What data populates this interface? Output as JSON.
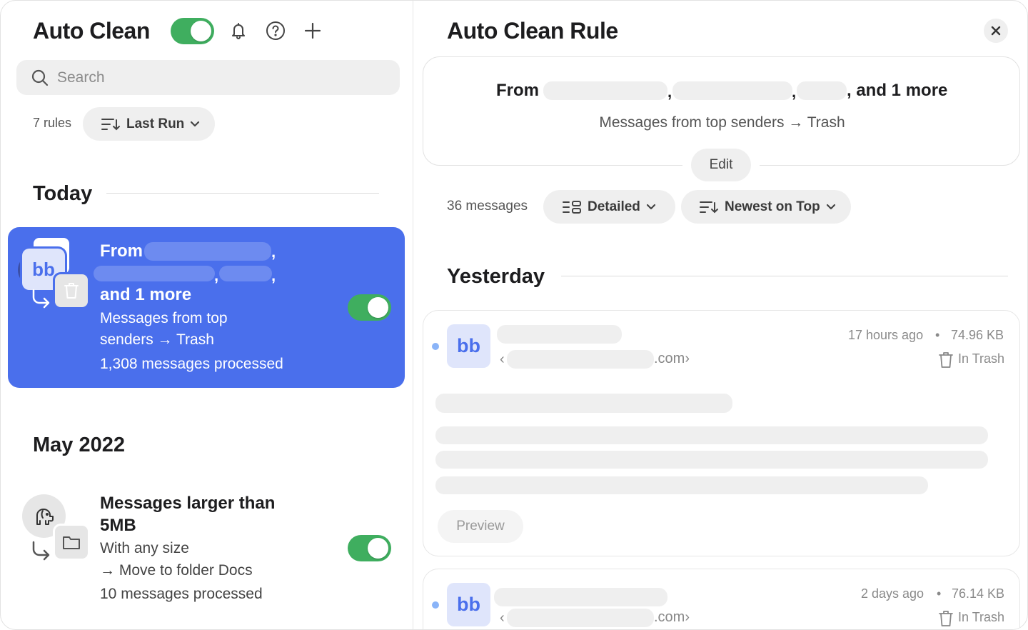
{
  "left": {
    "app_title": "Auto Clean",
    "search_placeholder": "Search",
    "rules_count": "7 rules",
    "sort_label": "Last Run",
    "sections": [
      {
        "title": "Today",
        "rule": {
          "from_label": "From",
          "more_label": "and 1 more",
          "description_line1": "Messages from top",
          "description_line2": "senders → Trash",
          "processed": "1,308 messages processed",
          "avatar_text": "bb",
          "enabled": true
        }
      },
      {
        "title": "May 2022",
        "rule": {
          "title_line1": "Messages larger than",
          "title_line2": "5MB",
          "description_line1": "With any size",
          "description_line2": "→ Move to folder Docs",
          "processed": "10 messages processed",
          "enabled": true
        }
      }
    ]
  },
  "right": {
    "title": "Auto Clean Rule",
    "summary": {
      "from_label": "From",
      "more_label": ", and 1 more",
      "description": "Messages from top senders → Trash",
      "edit_label": "Edit"
    },
    "message_count": "36 messages",
    "view_label": "Detailed",
    "order_label": "Newest on Top",
    "section_title": "Yesterday",
    "messages": [
      {
        "avatar_text": "bb",
        "domain_suffix": ".com›",
        "open_bracket": "‹",
        "time": "17 hours ago",
        "separator": "•",
        "size": "74.96 KB",
        "status": "In Trash",
        "preview_label": "Preview"
      },
      {
        "avatar_text": "bb",
        "domain_suffix": ".com›",
        "open_bracket": "‹",
        "time": "2 days ago",
        "separator": "•",
        "size": "76.14 KB",
        "status": "In Trash"
      }
    ]
  },
  "colors": {
    "accent_blue": "#4a6fec",
    "toggle_green": "#3fae5f",
    "unread_dot": "#8ab4f8"
  }
}
